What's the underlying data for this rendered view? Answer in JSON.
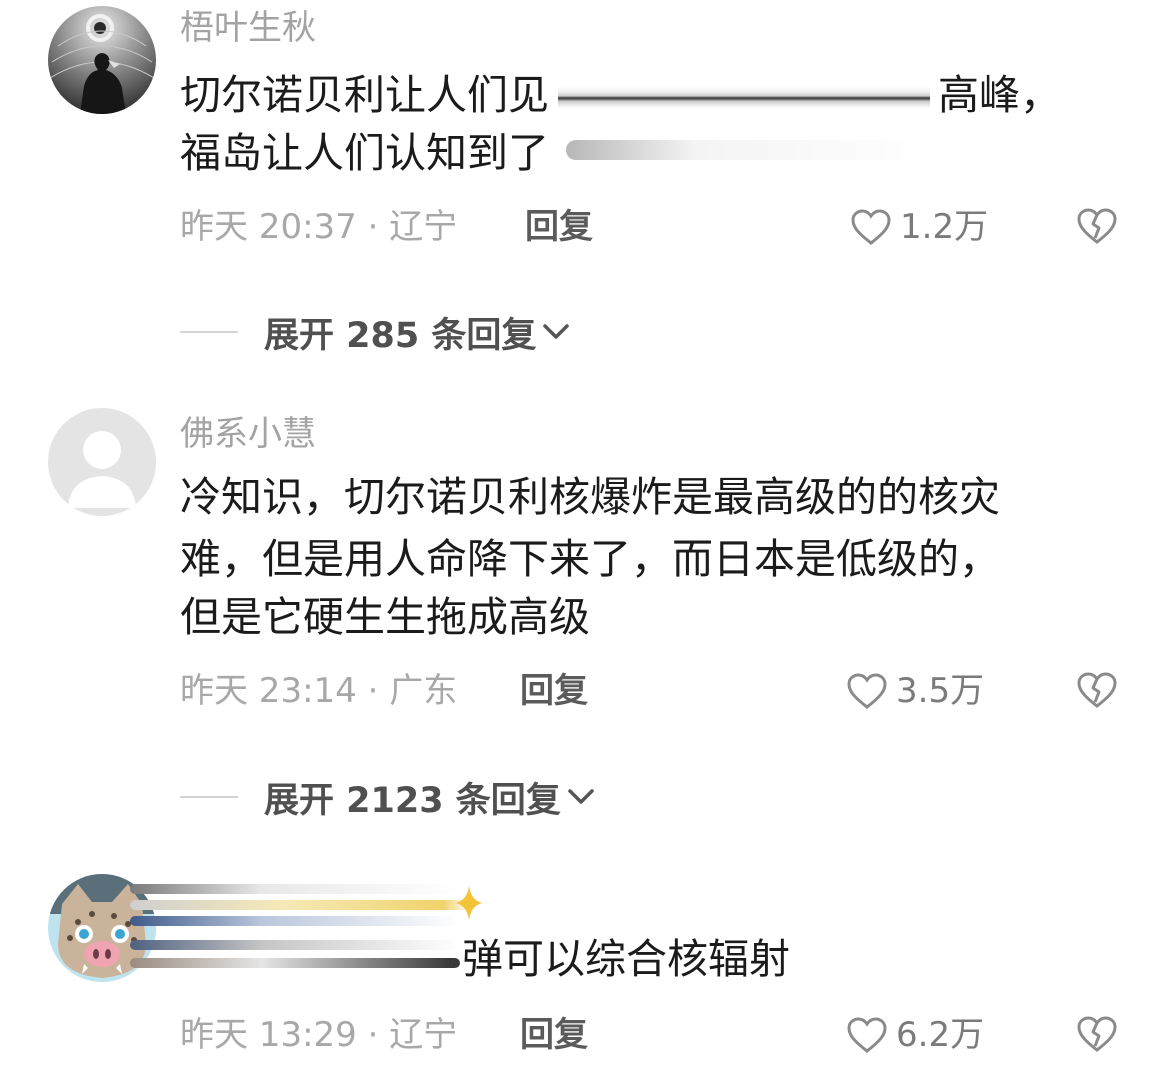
{
  "comments": [
    {
      "author": "梧叶生秋",
      "lines": [
        "切尔诺贝利让人们见",
        "高峰，",
        "福岛让人们认知到了"
      ],
      "time": "昨天 20:37 · 辽宁",
      "reply_label": "回复",
      "likes": "1.2万"
    },
    {
      "author": "佛系小慧",
      "lines": [
        "冷知识，切尔诺贝利核爆炸是最高级的的核灾",
        "难，但是用人命降下来了，而日本是低级的，",
        "但是它硬生生拖成高级"
      ],
      "time": "昨天 23:14 · 广东",
      "reply_label": "回复",
      "likes": "3.5万"
    },
    {
      "author": "",
      "lines": [
        "弹可以综合核辐射"
      ],
      "time": "昨天 13:29 · 辽宁",
      "reply_label": "回复",
      "likes": "6.2万"
    }
  ],
  "expands": [
    {
      "label": "展开 285 条回复"
    },
    {
      "label": "展开 2123 条回复"
    }
  ],
  "icons": {
    "like": "heart-outline-icon",
    "dislike": "broken-heart-icon",
    "expand": "chevron-down-icon"
  },
  "colors": {
    "text": "#1b1b1b",
    "muted": "#a8a8a8",
    "reply": "#5b5b5b"
  }
}
